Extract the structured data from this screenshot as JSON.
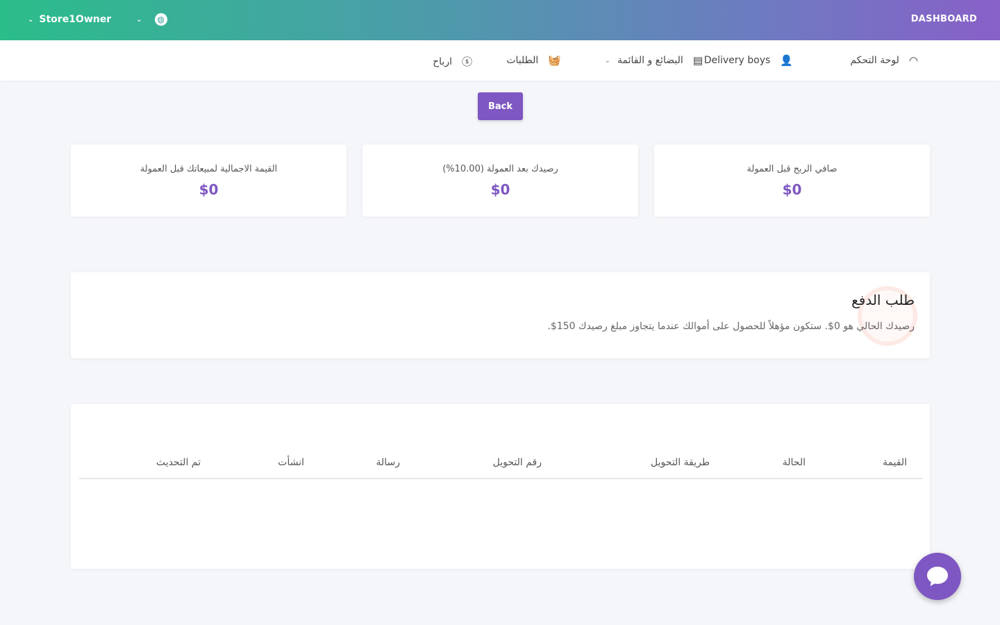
{
  "header": {
    "brand": "DASHBOARD",
    "user_name": "Store1Owner"
  },
  "nav": {
    "items": [
      {
        "label": "لوحة التحكم",
        "icon": "speedometer-icon"
      },
      {
        "label": "Delivery boys",
        "icon": "user-icon"
      },
      {
        "label": "البضائع و القائمة",
        "icon": "list-icon"
      },
      {
        "label": "الطلبات",
        "icon": "basket-icon"
      },
      {
        "label": "ارباح",
        "icon": "dollar-circle-icon"
      }
    ]
  },
  "back_label": "Back",
  "stats": [
    {
      "label": "صافي الربح قبل العمولة",
      "value": "$0"
    },
    {
      "label": "رصيدك بعد العمولة (10.00%)",
      "value": "$0"
    },
    {
      "label": "القيمة الاجمالية لمبيعاتك قبل العمولة",
      "value": "$0"
    }
  ],
  "payout": {
    "title": "طلب الدفع",
    "description": "رصيدك الحالي هو 0$. ستكون مؤهلاً للحصول على أموالك عندما يتجاوز مبلغ رصيدك 150$."
  },
  "table": {
    "headers": [
      "القيمة",
      "الحالة",
      "طريقة التحويل",
      "رقم التحويل",
      "رسالة",
      "انشأت",
      "تم التحديث"
    ]
  },
  "colors": {
    "accent": "#7e57c2",
    "header_gradient_start": "#2bbd8a",
    "header_gradient_end": "#8860c8"
  }
}
